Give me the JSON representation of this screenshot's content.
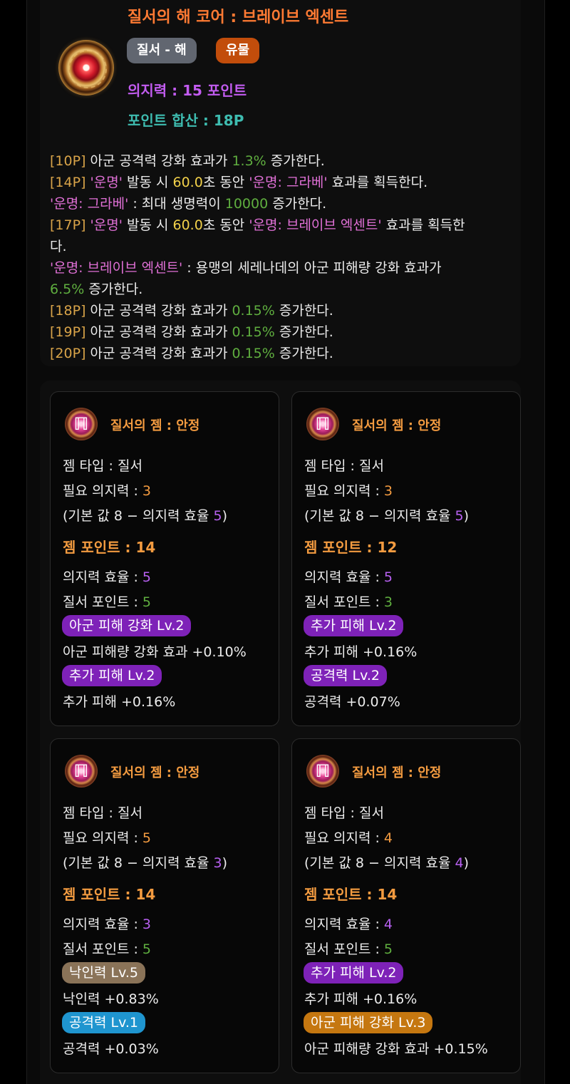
{
  "core": {
    "title": "질서의 해 코어 : 브레이브 엑센트",
    "tag_type": "질서 - 해",
    "tag_grade": "유물",
    "willpower": "의지력 : 15 포인트",
    "points_sum": "포인트 합산 : 18P"
  },
  "effects": [
    [
      {
        "t": "[10P]",
        "c": "gold"
      },
      {
        "t": " 아군 공격력 강화 효과가 "
      },
      {
        "t": "1.3%",
        "c": "green"
      },
      {
        "t": " 증가한다."
      }
    ],
    [
      {
        "t": "[14P]",
        "c": "gold"
      },
      {
        "t": " "
      },
      {
        "t": "'운명'",
        "c": "pink"
      },
      {
        "t": " 발동 시 "
      },
      {
        "t": "60.0",
        "c": "yellow"
      },
      {
        "t": "초 동안 "
      },
      {
        "t": "'운명: 그라베'",
        "c": "pink"
      },
      {
        "t": " 효과를 획득한다."
      }
    ],
    [
      {
        "t": "'운명: 그라베'",
        "c": "pink"
      },
      {
        "t": " : 최대 생명력이 "
      },
      {
        "t": "10000",
        "c": "green"
      },
      {
        "t": " 증가한다."
      }
    ],
    [
      {
        "t": "[17P]",
        "c": "gold"
      },
      {
        "t": " "
      },
      {
        "t": "'운명'",
        "c": "pink"
      },
      {
        "t": " 발동 시 "
      },
      {
        "t": "60.0",
        "c": "yellow"
      },
      {
        "t": "초 동안 "
      },
      {
        "t": "'운명: 브레이브 엑센트'",
        "c": "pink"
      },
      {
        "t": " 효과를 획득한"
      }
    ],
    [
      {
        "t": "다."
      }
    ],
    [
      {
        "t": "'운명: 브레이브 엑센트'",
        "c": "pink"
      },
      {
        "t": " : 용맹의 세레나데의 아군 피해량 강화 효과가"
      }
    ],
    [
      {
        "t": "6.5%",
        "c": "green"
      },
      {
        "t": " 증가한다."
      }
    ],
    [
      {
        "t": "[18P]",
        "c": "gold"
      },
      {
        "t": " 아군 공격력 강화 효과가 "
      },
      {
        "t": "0.15%",
        "c": "green"
      },
      {
        "t": " 증가한다."
      }
    ],
    [
      {
        "t": "[19P]",
        "c": "gold"
      },
      {
        "t": " 아군 공격력 강화 효과가 "
      },
      {
        "t": "0.15%",
        "c": "green"
      },
      {
        "t": " 증가한다."
      }
    ],
    [
      {
        "t": "[20P]",
        "c": "gold"
      },
      {
        "t": " 아군 공격력 강화 효과가 "
      },
      {
        "t": "0.15%",
        "c": "green"
      },
      {
        "t": " 증가한다."
      }
    ]
  ],
  "gems": [
    {
      "name": "질서의 젬 : 안정",
      "type_label": "젬 타입 : 질서",
      "req_label": "필요 의지력 : ",
      "req_value": "3",
      "base_prefix": "(기본 값 8 − 의지력 효율 ",
      "base_eff": "5",
      "base_suffix": ")",
      "points": "젬 포인트 : 14",
      "eff_label": "의지력 효율 : ",
      "eff_value": "5",
      "order_label": "질서 포인트 : ",
      "order_value": "5",
      "opt1_name": "아군 피해 강화 Lv.2",
      "opt1_color": "#7e22b8",
      "opt1_desc": "아군 피해량 강화 효과 +0.10%",
      "opt2_name": "추가 피해 Lv.2",
      "opt2_color": "#7e22b8",
      "opt2_desc": "추가 피해 +0.16%"
    },
    {
      "name": "질서의 젬 : 안정",
      "type_label": "젬 타입 : 질서",
      "req_label": "필요 의지력 : ",
      "req_value": "3",
      "base_prefix": "(기본 값 8 − 의지력 효율 ",
      "base_eff": "5",
      "base_suffix": ")",
      "points": "젬 포인트 : 12",
      "eff_label": "의지력 효율 : ",
      "eff_value": "5",
      "order_label": "질서 포인트 : ",
      "order_value": "3",
      "opt1_name": "추가 피해 Lv.2",
      "opt1_color": "#7e22b8",
      "opt1_desc": "추가 피해 +0.16%",
      "opt2_name": "공격력 Lv.2",
      "opt2_color": "#7e22b8",
      "opt2_desc": "공격력 +0.07%"
    },
    {
      "name": "질서의 젬 : 안정",
      "type_label": "젬 타입 : 질서",
      "req_label": "필요 의지력 : ",
      "req_value": "5",
      "base_prefix": "(기본 값 8 − 의지력 효율 ",
      "base_eff": "3",
      "base_suffix": ")",
      "points": "젬 포인트 : 14",
      "eff_label": "의지력 효율 : ",
      "eff_value": "3",
      "order_label": "질서 포인트 : ",
      "order_value": "5",
      "opt1_name": "낙인력 Lv.5",
      "opt1_color": "#8a7358",
      "opt1_desc": "낙인력 +0.83%",
      "opt2_name": "공격력 Lv.1",
      "opt2_color": "#1f95cf",
      "opt2_desc": "공격력 +0.03%"
    },
    {
      "name": "질서의 젬 : 안정",
      "type_label": "젬 타입 : 질서",
      "req_label": "필요 의지력 : ",
      "req_value": "4",
      "base_prefix": "(기본 값 8 − 의지력 효율 ",
      "base_eff": "4",
      "base_suffix": ")",
      "points": "젬 포인트 : 14",
      "eff_label": "의지력 효율 : ",
      "eff_value": "4",
      "order_label": "질서 포인트 : ",
      "order_value": "5",
      "opt1_name": "추가 피해 Lv.2",
      "opt1_color": "#7e22b8",
      "opt1_desc": "추가 피해 +0.16%",
      "opt2_name": "아군 피해 강화 Lv.3",
      "opt2_color": "#c57710",
      "opt2_desc": "아군 피해량 강화 효과 +0.15%"
    }
  ]
}
